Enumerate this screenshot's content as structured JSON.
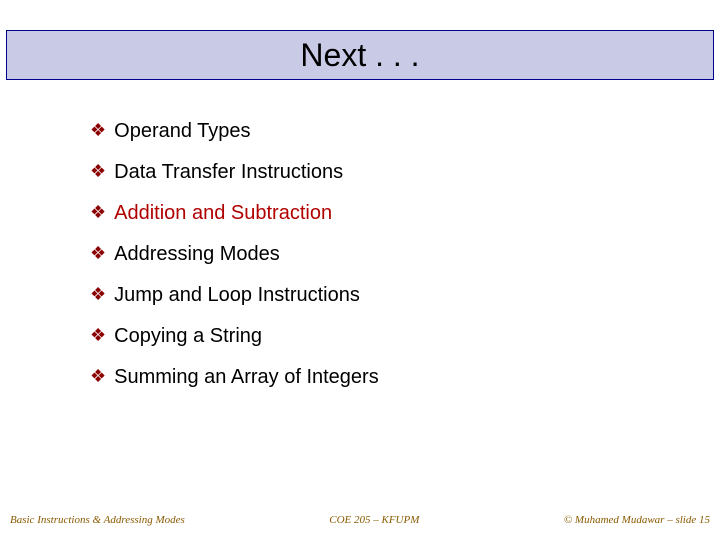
{
  "title": "Next . . .",
  "bullets": [
    {
      "text": "Operand Types",
      "highlight": false
    },
    {
      "text": "Data Transfer Instructions",
      "highlight": false
    },
    {
      "text": "Addition and Subtraction",
      "highlight": true
    },
    {
      "text": "Addressing Modes",
      "highlight": false
    },
    {
      "text": "Jump and Loop Instructions",
      "highlight": false
    },
    {
      "text": "Copying a String",
      "highlight": false
    },
    {
      "text": "Summing an Array of Integers",
      "highlight": false
    }
  ],
  "footer": {
    "left": "Basic Instructions & Addressing Modes",
    "center": "COE 205 – KFUPM",
    "right": "© Muhamed Mudawar – slide 15"
  },
  "bullet_glyph": "❖"
}
